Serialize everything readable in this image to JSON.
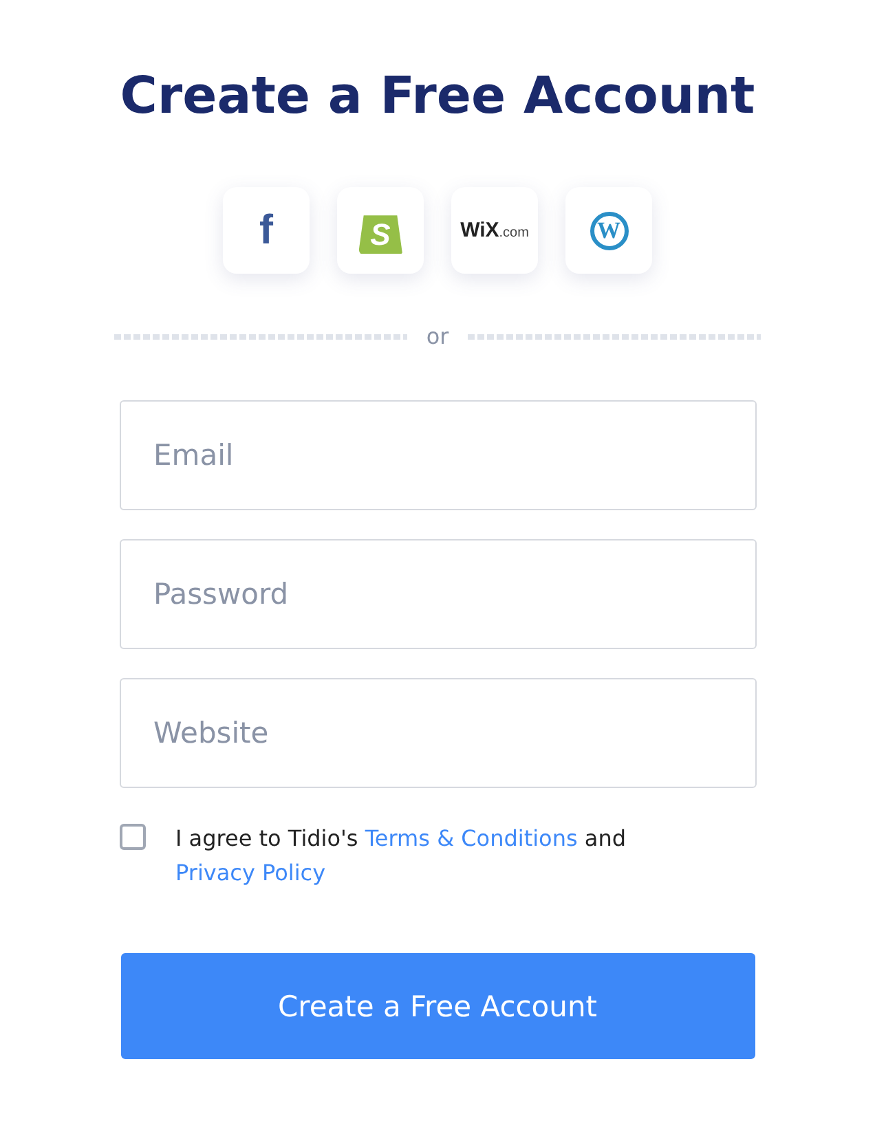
{
  "title": "Create a Free Account",
  "social": [
    {
      "kind": "facebook",
      "text": "f"
    },
    {
      "kind": "shopify",
      "text": "S"
    },
    {
      "kind": "wix",
      "text": "WiX",
      "suffix": ".com"
    },
    {
      "kind": "wordpress",
      "text": "W"
    }
  ],
  "divider": "or",
  "fields": [
    {
      "placeholder": "Email"
    },
    {
      "placeholder": "Password"
    },
    {
      "placeholder": "Website"
    }
  ],
  "agreement": {
    "checked": false,
    "parts": [
      {
        "kind": "text",
        "text": "I agree to Tidio's "
      },
      {
        "kind": "link",
        "text": "Terms & Conditions"
      },
      {
        "kind": "text",
        "text": " and "
      },
      {
        "kind": "link",
        "text": "Privacy Policy"
      }
    ]
  },
  "submit": "Create a Free Account"
}
